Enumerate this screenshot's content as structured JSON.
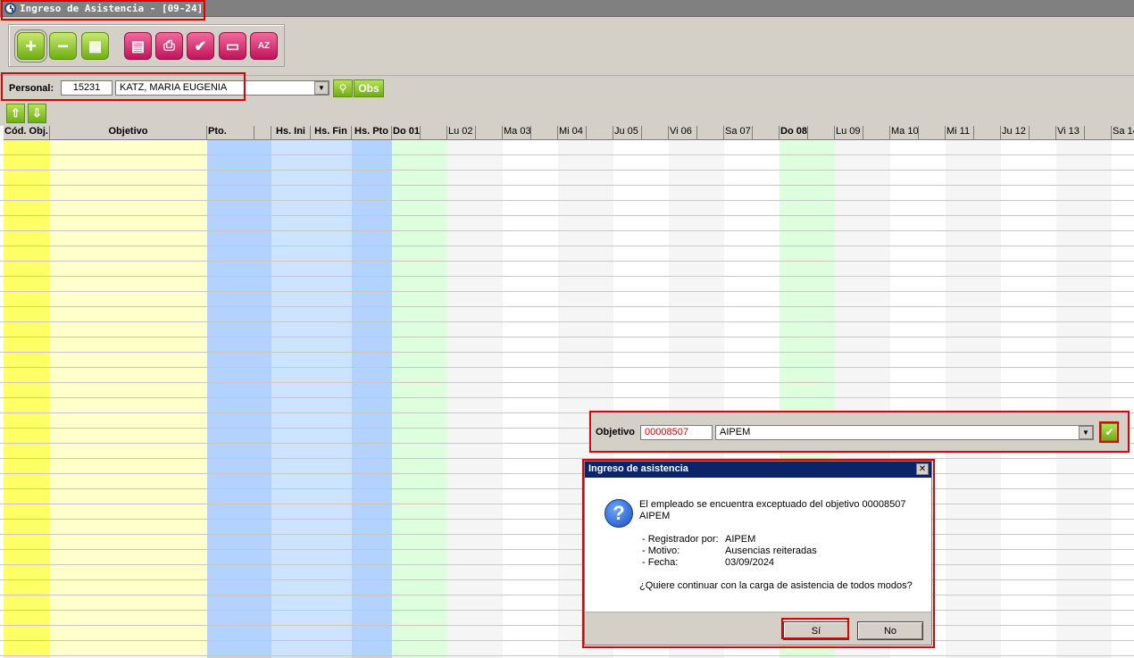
{
  "window": {
    "title": "Ingreso de Asistencia - [09-24]"
  },
  "toolbar": {
    "buttons": [
      {
        "name": "add",
        "icon": "plus-icon",
        "glyph": "+"
      },
      {
        "name": "remove",
        "icon": "minus-icon",
        "glyph": "−"
      },
      {
        "name": "calculator",
        "icon": "calculator-icon",
        "glyph": "▦"
      },
      {
        "name": "clipboard",
        "icon": "clipboard-icon",
        "glyph": "▤"
      },
      {
        "name": "print",
        "icon": "printer-icon",
        "glyph": "⎙"
      },
      {
        "name": "check",
        "icon": "check-icon",
        "glyph": "✔"
      },
      {
        "name": "display",
        "icon": "tv-icon",
        "glyph": "▭"
      },
      {
        "name": "sort",
        "icon": "sort-az-icon",
        "glyph": "AZ"
      }
    ]
  },
  "personal": {
    "label": "Personal:",
    "code": "15231",
    "name": "KATZ, MARIA EUGENIA",
    "obs_label": "Obs"
  },
  "grid": {
    "headers": {
      "cod_obj": "Cód. Obj.",
      "objetivo": "Objetivo",
      "pto": "Pto.",
      "hs_ini": "Hs. Ini",
      "hs_fin": "Hs. Fin",
      "hs_pto": "Hs. Pto",
      "days": [
        "Do 01",
        "Lu 02",
        "Ma 03",
        "Mi 04",
        "Ju 05",
        "Vi 06",
        "Sa 07",
        "Do 08",
        "Lu 09",
        "Ma 10",
        "Mi 11",
        "Ju 12",
        "Vi 13",
        "Sa 14"
      ]
    }
  },
  "objetivo_panel": {
    "label": "Objetivo",
    "code": "00008507",
    "name": "AIPEM"
  },
  "dialog": {
    "title": "Ingreso de asistencia",
    "message_line1": "El empleado se encuentra exceptuado del objetivo 00008507",
    "message_line2": "AIPEM",
    "details": [
      {
        "label": "- Registrador por:",
        "value": "AIPEM"
      },
      {
        "label": "- Motivo:",
        "value": "Ausencias reiteradas"
      },
      {
        "label": "- Fecha:",
        "value": "03/09/2024"
      }
    ],
    "question": "¿Quiere continuar con la carga de asistencia de todos modos?",
    "yes_label": "Sí",
    "no_label": "No"
  },
  "colors": {
    "yellow_col": "#ffff66",
    "light_yellow": "#ffffcc",
    "blue_col": "#b4d2ff",
    "light_blue": "#cce4ff",
    "green_col": "#ddffdd",
    "accent_red": "#e00000",
    "dialog_title": "#0a246a"
  }
}
